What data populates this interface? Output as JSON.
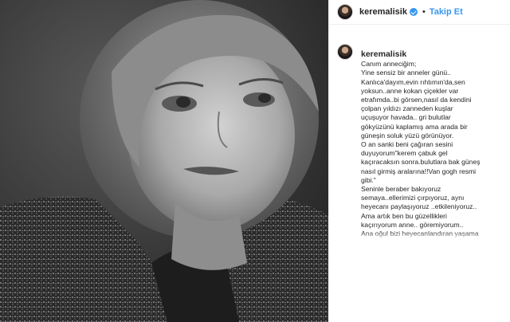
{
  "post": {
    "username": "keremalisik",
    "follow_label": "Takip Et",
    "separator": "•",
    "caption_lines": [
      "Canım anneciğim;",
      "Yine sensiz bir anneler günü..",
      "Kanlıca'dayım,evin rıhtımın'da,sen",
      "yoksun..anne kokan çiçekler var",
      "etrafımda..bi görsen,nasıl da kendini",
      "çolpan yıldızı zanneden kuşlar",
      "uçuşuyor havada.. gri bulutlar",
      "gökyüzünü kaplamış ama arada bir",
      "güneşin soluk yüzü görünüyor.",
      "O an sanki beni çağıran sesini",
      "duyuyorum\"kerem çabuk gel",
      "kaçıracaksın sonra.bulutlara bak güneş",
      "nasıl girmiş aralarına!!Van gogh resmi",
      "gibi.\"",
      "Seninle beraber bakıyoruz",
      "semaya..ellerimizi çırpıyoruz, aynı",
      "heyecanı paylaşıyoruz ..etkileniyoruz..",
      "Ama artık ben bu güzellikleri",
      "kaçırıyorum anne.. göremiyorum..",
      "Ana oğul bizi heyecanlandıran yaşama"
    ]
  },
  "colors": {
    "accent": "#3897f0",
    "text": "#262626",
    "border": "#efefef"
  }
}
